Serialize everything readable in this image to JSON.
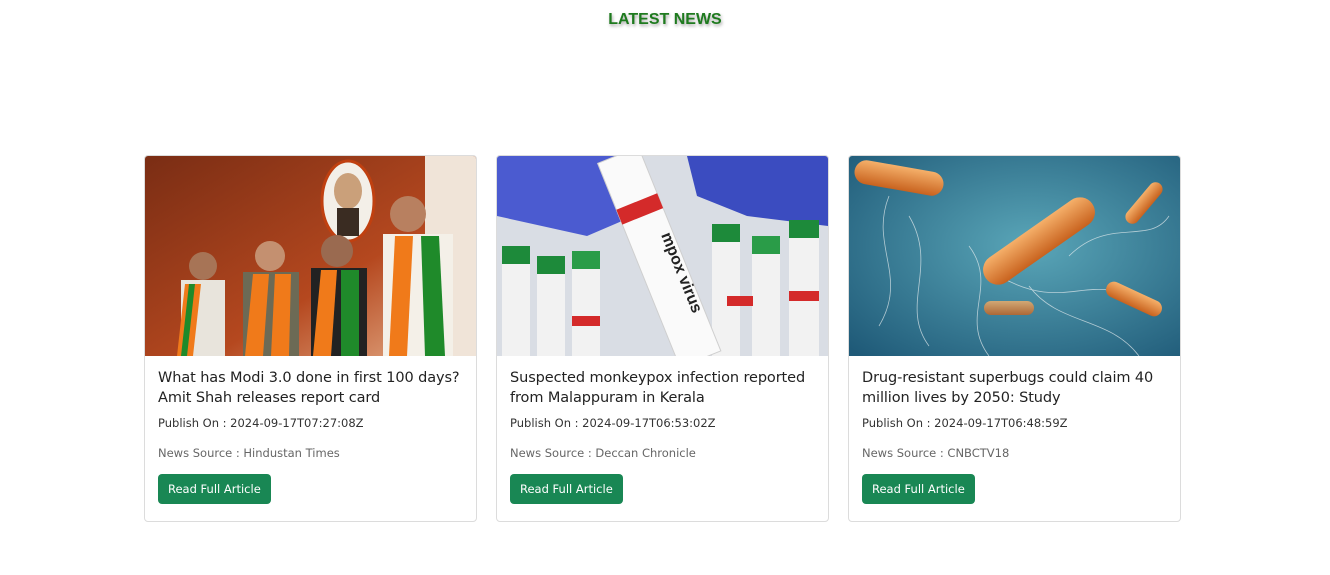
{
  "header": {
    "title": "LATEST NEWS"
  },
  "articles": [
    {
      "title": "What has Modi 3.0 done in first 100 days? Amit Shah releases report card",
      "publish": "Publish On : 2024-09-17T07:27:08Z",
      "source": "News Source : Hindustan Times",
      "button_label": "Read Full Article"
    },
    {
      "title": "Suspected monkeypox infection reported from Malappuram in Kerala",
      "publish": "Publish On : 2024-09-17T06:53:02Z",
      "source": "News Source : Deccan Chronicle",
      "button_label": "Read Full Article",
      "image_text": "mpox virus"
    },
    {
      "title": "Drug-resistant superbugs could claim 40 million lives by 2050: Study",
      "publish": "Publish On : 2024-09-17T06:48:59Z",
      "source": "News Source : CNBCTV18",
      "button_label": "Read Full Article"
    }
  ],
  "colors": {
    "heading": "#1e7a1e",
    "button": "#198754"
  }
}
